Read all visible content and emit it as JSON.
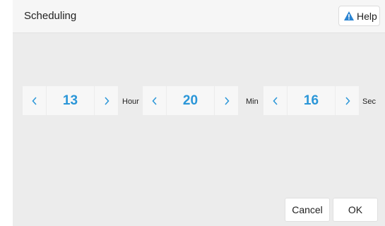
{
  "dialog": {
    "title": "Scheduling",
    "help_label": "Help"
  },
  "time": {
    "hour": {
      "value": "13",
      "unit": "Hour"
    },
    "minute": {
      "value": "20",
      "unit": "Min"
    },
    "second": {
      "value": "16",
      "unit": "Sec"
    }
  },
  "footer": {
    "cancel_label": "Cancel",
    "ok_label": "OK"
  },
  "colors": {
    "accent": "#2a96d8",
    "background": "#ececec"
  }
}
